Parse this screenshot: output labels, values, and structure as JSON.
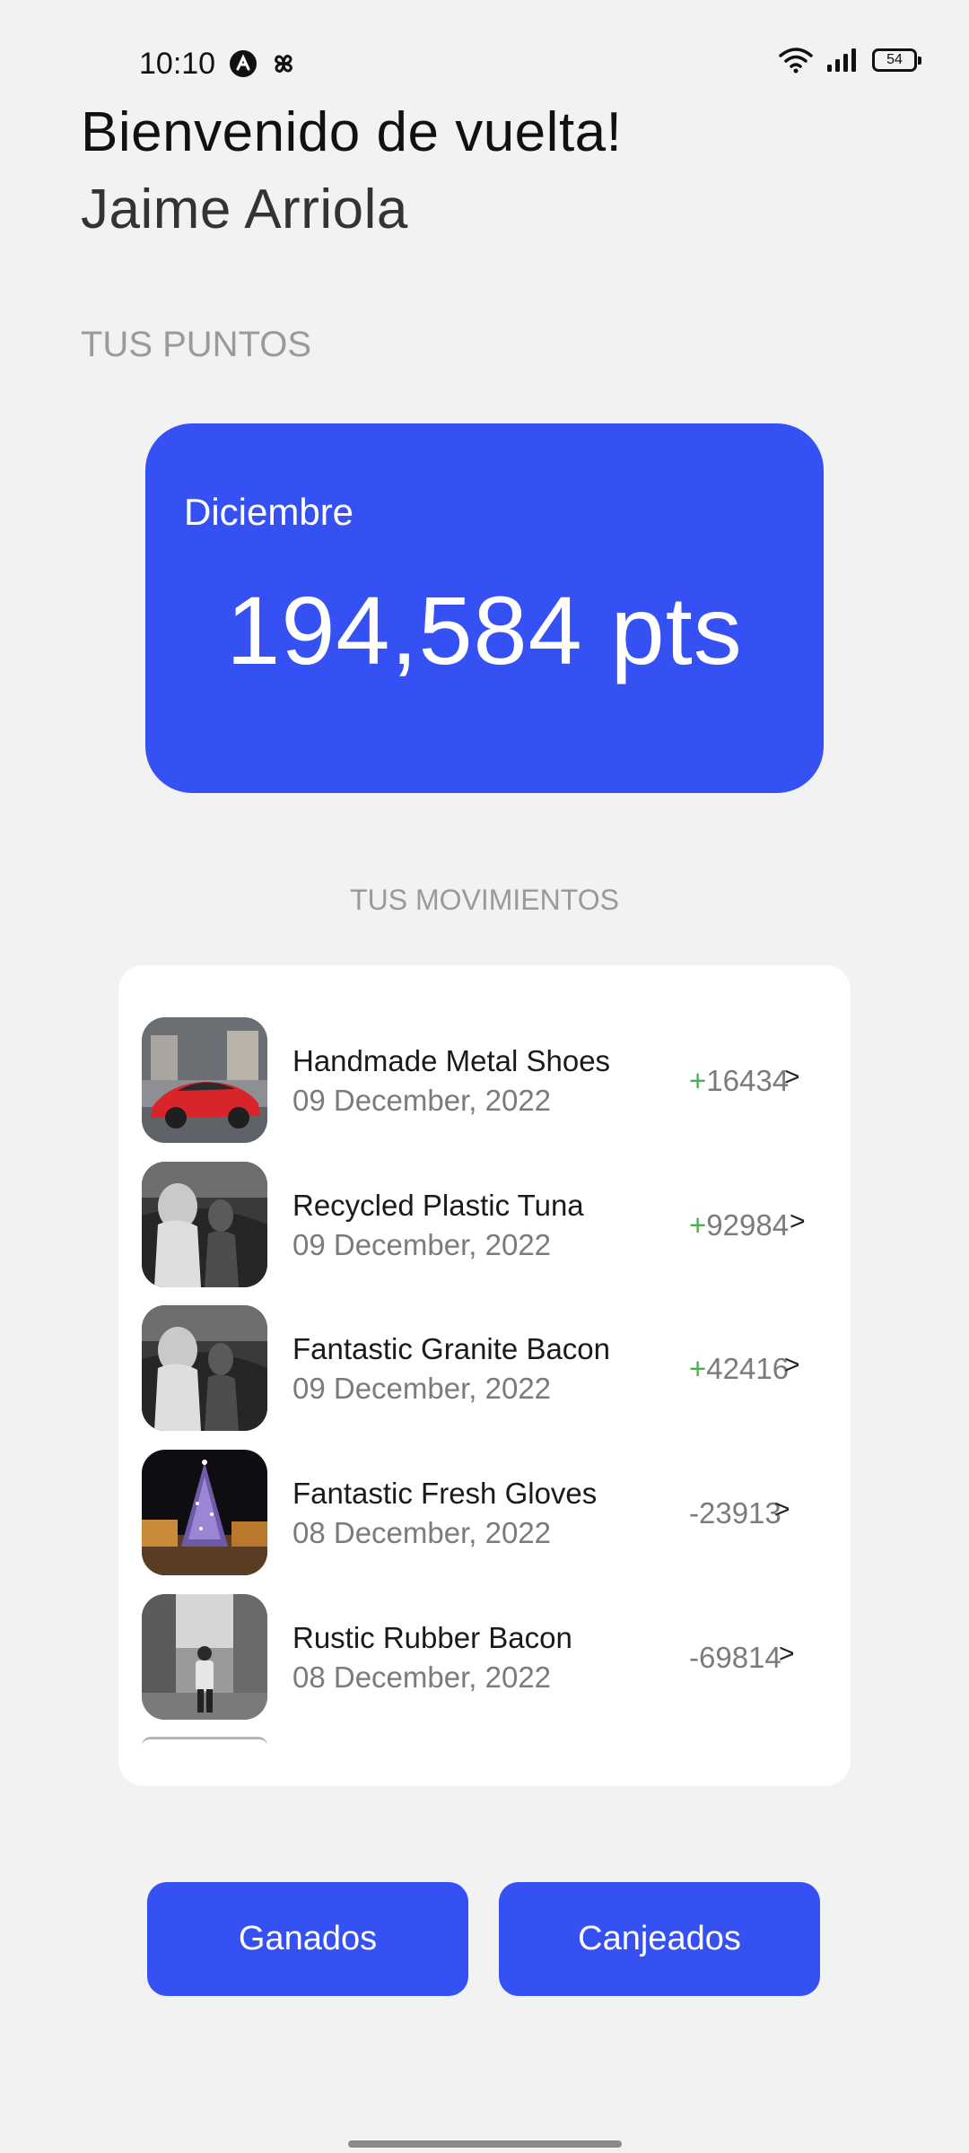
{
  "status_bar": {
    "time": "10:10",
    "battery": "54",
    "icons": [
      "notification-app-icon",
      "pinwheel-app-icon",
      "wifi-icon",
      "signal-icon",
      "battery-icon"
    ]
  },
  "greeting": {
    "title": "Bienvenido de vuelta!",
    "name": "Jaime Arriola"
  },
  "points_section": {
    "label": "TUS PUNTOS",
    "month": "Diciembre",
    "value": "194,584 pts"
  },
  "movements": {
    "title": "TUS MOVIMIENTOS",
    "items": [
      {
        "name": "Handmade Metal Shoes",
        "date": "09 December, 2022",
        "sign": "+",
        "amount": "16434",
        "arrow": ">",
        "thumb": "red-sports-car-photo"
      },
      {
        "name": "Recycled Plastic Tuna",
        "date": "09 December, 2022",
        "sign": "+",
        "amount": "92984",
        "arrow": ">",
        "thumb": "bw-people-photo"
      },
      {
        "name": "Fantastic Granite Bacon",
        "date": "09 December, 2022",
        "sign": "+",
        "amount": "42416",
        "arrow": ">",
        "thumb": "bw-people-photo"
      },
      {
        "name": "Fantastic Fresh Gloves",
        "date": "08 December, 2022",
        "sign": "",
        "amount": "-23913",
        "arrow": ">",
        "thumb": "christmas-tree-photo"
      },
      {
        "name": "Rustic Rubber Bacon",
        "date": "08 December, 2022",
        "sign": "",
        "amount": "-69814",
        "arrow": ">",
        "thumb": "bw-alley-photo"
      }
    ]
  },
  "buttons": {
    "earned": "Ganados",
    "redeemed": "Canjeados"
  },
  "colors": {
    "accent": "#3551f4",
    "background": "#f2f2f2",
    "positive": "#4caf50"
  }
}
